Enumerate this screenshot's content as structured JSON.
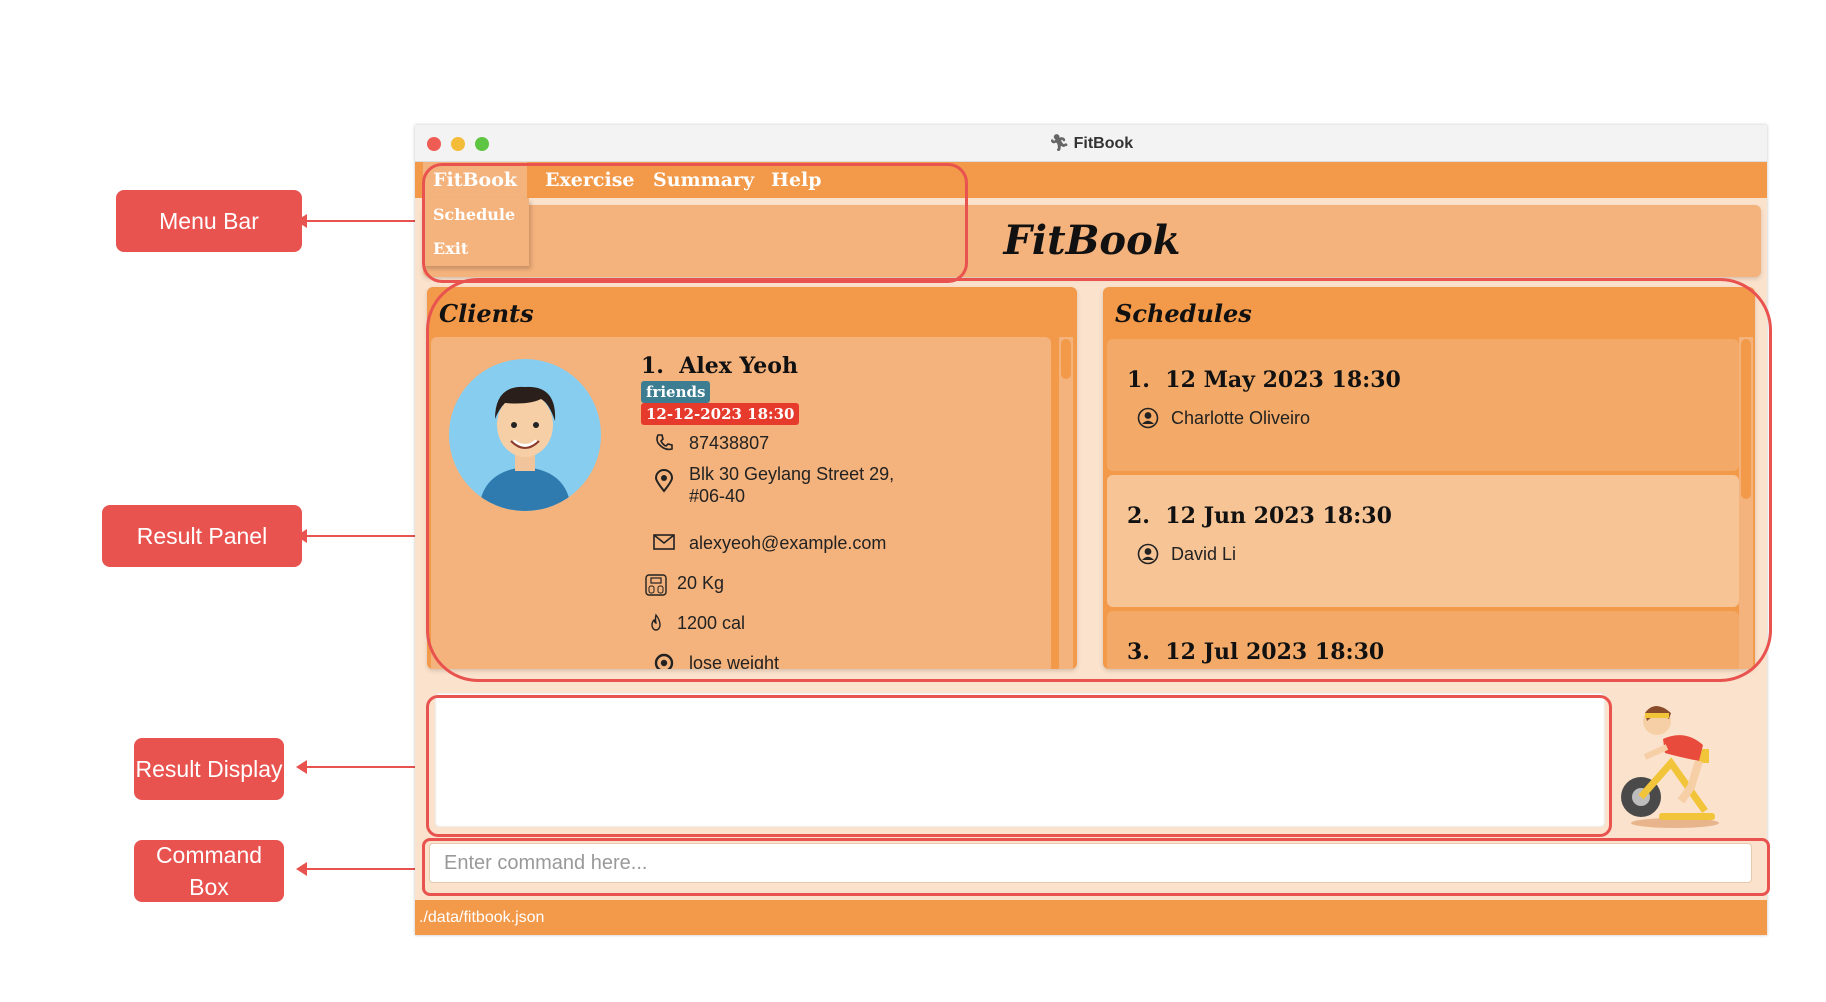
{
  "callouts": {
    "menu_bar": "Menu Bar",
    "result_panel": "Result Panel",
    "result_display": "Result Display",
    "command_box": "Command Box"
  },
  "window": {
    "title": "FitBook"
  },
  "menu": {
    "items": [
      "FitBook",
      "Exercise",
      "Summary",
      "Help"
    ],
    "dropdown": [
      "Schedule",
      "Exit"
    ]
  },
  "header": {
    "title": "FitBook"
  },
  "clients": {
    "title": "Clients",
    "client": {
      "index": "1.",
      "name": "Alex Yeoh",
      "tags": [
        "friends",
        "12-12-2023 18:30"
      ],
      "phone": "87438807",
      "address_line1": "Blk 30 Geylang Street 29,",
      "address_line2": "#06-40",
      "email": "alexyeoh@example.com",
      "weight": "20 Kg",
      "calories": "1200 cal",
      "goal": "lose weight"
    }
  },
  "schedules": {
    "title": "Schedules",
    "items": [
      {
        "index": "1.",
        "date": "12 May 2023 18:30",
        "person": "Charlotte Oliveiro"
      },
      {
        "index": "2.",
        "date": "12 Jun 2023 18:30",
        "person": "David Li"
      },
      {
        "index": "3.",
        "date": "12 Jul 2023 18:30",
        "person": ""
      }
    ]
  },
  "result_display": {
    "text": ""
  },
  "command": {
    "placeholder": "Enter command here...",
    "value": ""
  },
  "status": {
    "path": "./data/fitbook.json"
  },
  "colors": {
    "primary": "#f2994a",
    "secondary": "#f4b27c",
    "background": "#fbe2cc",
    "accent": "#e9534f",
    "tag_blue": "#3d7d91",
    "tag_red": "#e63a2c"
  }
}
